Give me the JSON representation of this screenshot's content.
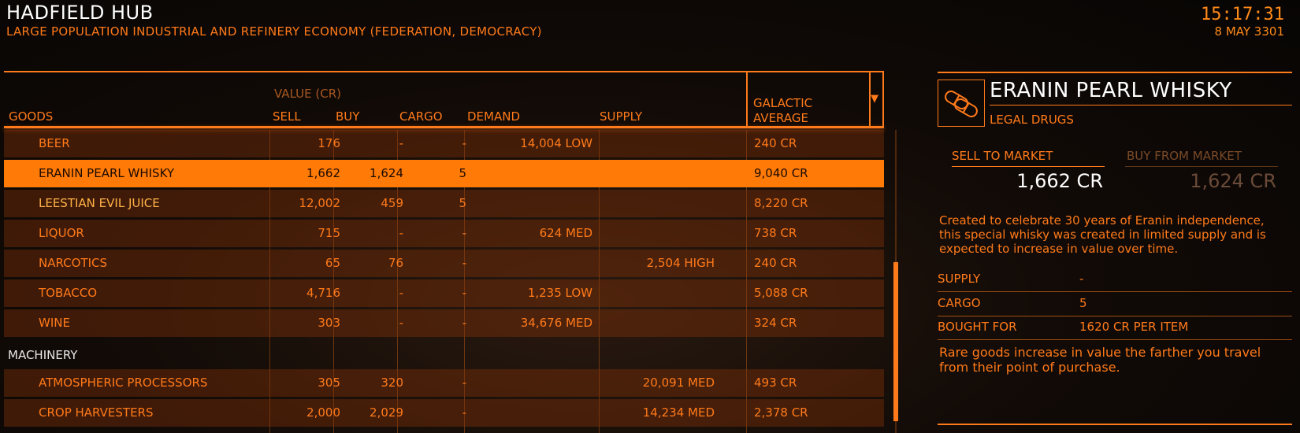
{
  "header": {
    "station_name": "HADFIELD HUB",
    "station_description": "LARGE POPULATION INDUSTRIAL AND REFINERY ECONOMY (FEDERATION, DEMOCRACY)",
    "time": "15:17:31",
    "date": "8 MAY 3301"
  },
  "table_header": {
    "goods": "GOODS",
    "value_group": "VALUE (CR)",
    "sell": "SELL",
    "buy": "BUY",
    "cargo": "CARGO",
    "demand": "DEMAND",
    "supply": "SUPPLY",
    "galactic_average_line1": "GALACTIC",
    "galactic_average_line2": "AVERAGE",
    "sort_icon": "triangle-down"
  },
  "rows": [
    {
      "type": "item",
      "name": "BEER",
      "sell": "176",
      "buy": "-",
      "cargo": "-",
      "demand": "14,004 LOW",
      "supply": "",
      "avg": "240 CR"
    },
    {
      "type": "selected",
      "name": "ERANIN PEARL WHISKY",
      "sell": "1,662",
      "buy": "1,624",
      "cargo": "5",
      "demand": "",
      "supply": "",
      "avg": "9,040 CR"
    },
    {
      "type": "item",
      "rare": true,
      "name": "LEESTIAN EVIL JUICE",
      "sell": "12,002",
      "buy": "459",
      "cargo": "5",
      "demand": "",
      "supply": "",
      "avg": "8,220 CR"
    },
    {
      "type": "item",
      "name": "LIQUOR",
      "sell": "715",
      "buy": "-",
      "cargo": "-",
      "demand": "624 MED",
      "supply": "",
      "avg": "738 CR"
    },
    {
      "type": "item",
      "name": "NARCOTICS",
      "sell": "65",
      "buy": "76",
      "cargo": "-",
      "demand": "",
      "supply": "2,504 HIGH",
      "avg": "240 CR"
    },
    {
      "type": "item",
      "name": "TOBACCO",
      "sell": "4,716",
      "buy": "-",
      "cargo": "-",
      "demand": "1,235 LOW",
      "supply": "",
      "avg": "5,088 CR"
    },
    {
      "type": "item",
      "name": "WINE",
      "sell": "303",
      "buy": "-",
      "cargo": "-",
      "demand": "34,676 MED",
      "supply": "",
      "avg": "324 CR"
    },
    {
      "type": "category",
      "name": "MACHINERY"
    },
    {
      "type": "item",
      "name": "ATMOSPHERIC PROCESSORS",
      "sell": "305",
      "buy": "320",
      "cargo": "-",
      "demand": "",
      "supply": "20,091 MED",
      "avg": "493 CR"
    },
    {
      "type": "item",
      "name": "CROP HARVESTERS",
      "sell": "2,000",
      "buy": "2,029",
      "cargo": "-",
      "demand": "",
      "supply": "14,234 MED",
      "avg": "2,378 CR"
    }
  ],
  "detail": {
    "title": "ERANIN PEARL WHISKY",
    "category": "LEGAL DRUGS",
    "icon": "pills-icon",
    "tab_sell": "SELL TO MARKET",
    "tab_buy": "BUY FROM MARKET",
    "sell_price": "1,662 CR",
    "buy_price": "1,624 CR",
    "description": "Created to celebrate 30 years of Eranin independence, this special whisky was created in limited supply and is expected to increase in value over time.",
    "supply_label": "SUPPLY",
    "supply_value": "-",
    "cargo_label": "CARGO",
    "cargo_value": "5",
    "bought_label": "BOUGHT FOR",
    "bought_value": "1620 CR PER ITEM",
    "note": "Rare goods increase in value the farther you travel from their point of purchase."
  },
  "colors": {
    "accent": "#ff7a1a",
    "selected_row": "#ff7a06",
    "title_white": "#ffffff",
    "muted": "#7a4a28"
  }
}
